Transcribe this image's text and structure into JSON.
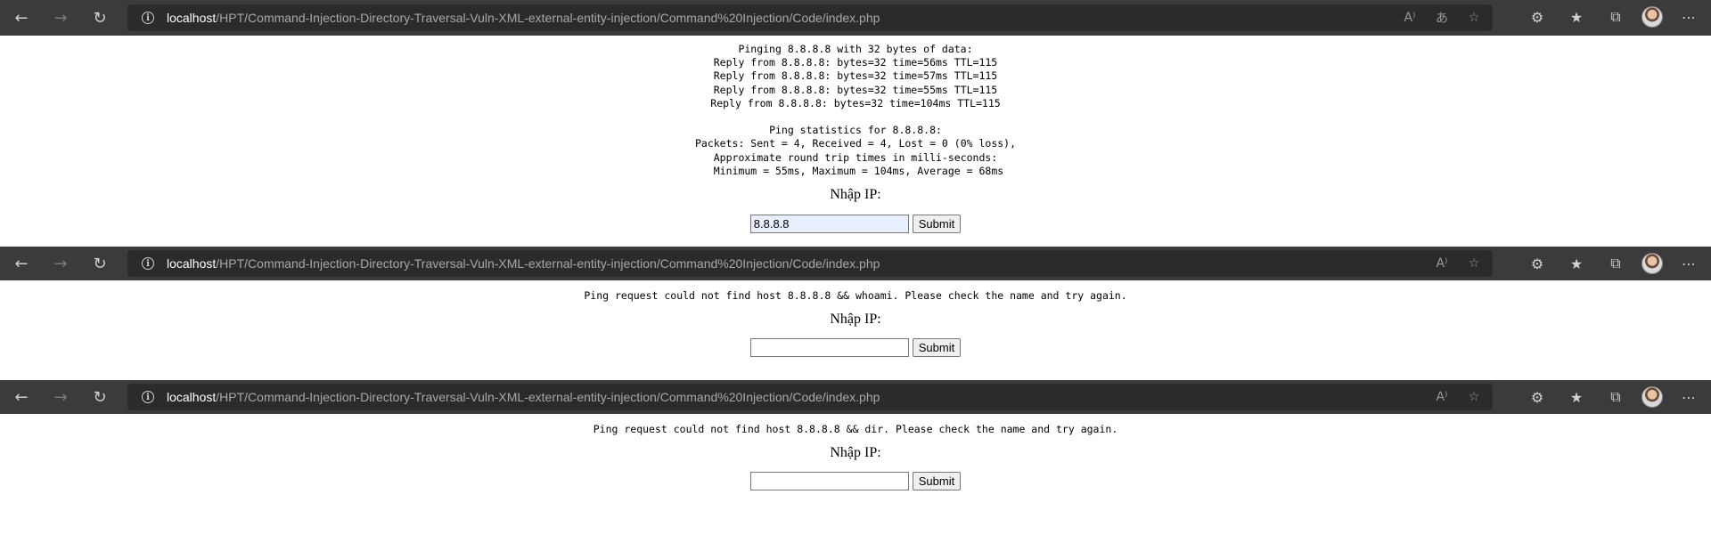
{
  "windows": [
    {
      "url_host": "localhost",
      "url_path": "/HPT/Command-Injection-Directory-Traversal-Vuln-XML-external-entity-injection/Command%20Injection/Code/index.php",
      "output": "Pinging 8.8.8.8 with 32 bytes of data:\nReply from 8.8.8.8: bytes=32 time=56ms TTL=115\nReply from 8.8.8.8: bytes=32 time=57ms TTL=115\nReply from 8.8.8.8: bytes=32 time=55ms TTL=115\nReply from 8.8.8.8: bytes=32 time=104ms TTL=115\n\nPing statistics for 8.8.8.8:\nPackets: Sent = 4, Received = 4, Lost = 0 (0% loss),\nApproximate round trip times in milli-seconds:\n Minimum = 55ms, Maximum = 104ms, Average = 68ms",
      "label": "Nhập IP:",
      "input_value": "8.8.8.8",
      "submit_label": "Submit"
    },
    {
      "url_host": "localhost",
      "url_path": "/HPT/Command-Injection-Directory-Traversal-Vuln-XML-external-entity-injection/Command%20Injection/Code/index.php",
      "output": "Ping request could not find host 8.8.8.8 && whoami. Please check the name and try again.",
      "label": "Nhập IP:",
      "input_value": "",
      "submit_label": "Submit"
    },
    {
      "url_host": "localhost",
      "url_path": "/HPT/Command-Injection-Directory-Traversal-Vuln-XML-external-entity-injection/Command%20Injection/Code/index.php",
      "output": "Ping request could not find host 8.8.8.8 && dir. Please check the name and try again.",
      "label": "Nhập IP:",
      "input_value": "",
      "submit_label": "Submit"
    }
  ],
  "icons": {
    "back": "back-arrow-icon",
    "forward": "forward-arrow-icon",
    "refresh": "refresh-icon",
    "info": "info-icon",
    "read_aloud": "read-aloud-icon",
    "translate": "translate-icon",
    "favorite_add": "add-favorite-icon",
    "extensions": "extensions-icon",
    "favorites": "favorites-icon",
    "collections": "collections-icon",
    "profile": "profile-avatar",
    "more": "more-icon"
  },
  "colors": {
    "toolbar": "#3b3b3b",
    "address_bar": "#2b2b2b",
    "url_host": "#ffffff",
    "url_path": "#a8a8a8"
  }
}
